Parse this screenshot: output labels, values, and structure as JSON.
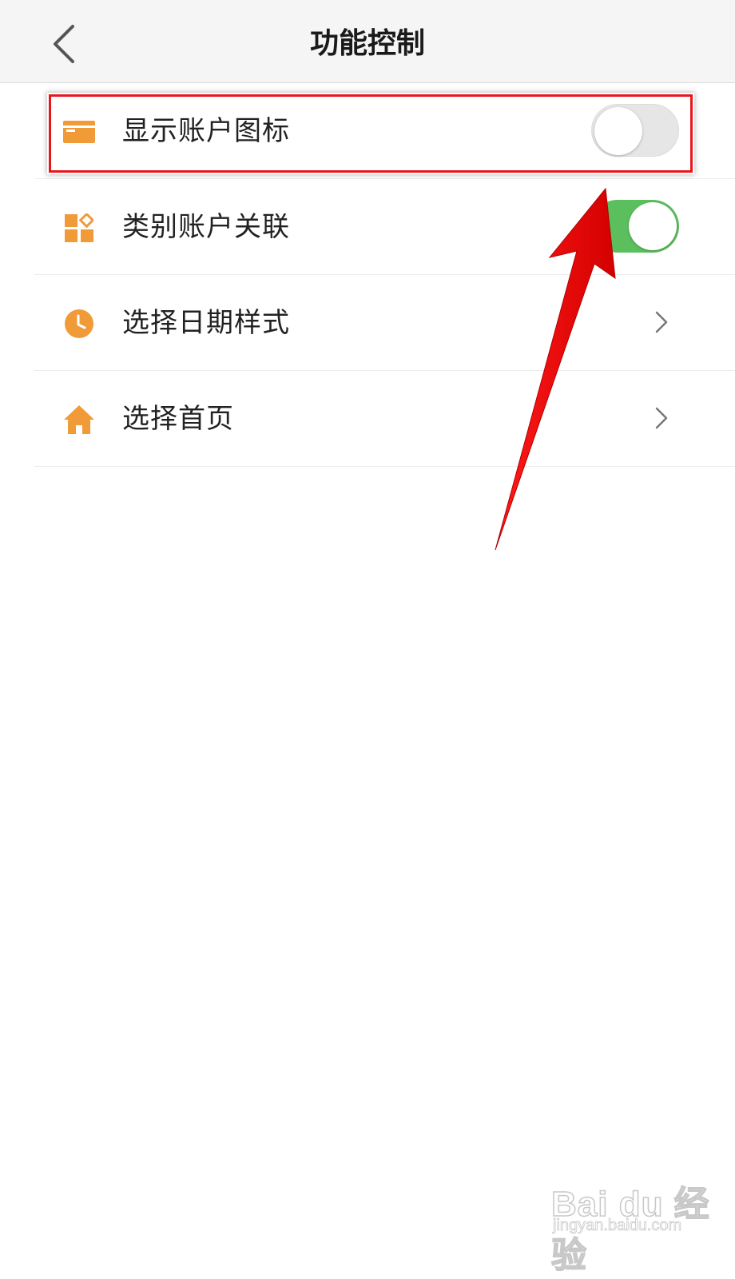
{
  "header": {
    "title": "功能控制",
    "back_icon": "chevron-left-icon"
  },
  "colors": {
    "icon_orange": "#f19a38",
    "toggle_on": "#5cbf5e",
    "toggle_off": "#e6e6e6",
    "annotation_red": "#e8161c"
  },
  "settings": {
    "items": [
      {
        "label": "显示账户图标",
        "icon": "card-icon",
        "control": "toggle",
        "state": "off"
      },
      {
        "label": "类别账户关联",
        "icon": "category-grid-icon",
        "control": "toggle",
        "state": "on"
      },
      {
        "label": "选择日期样式",
        "icon": "clock-icon",
        "control": "chevron"
      },
      {
        "label": "选择首页",
        "icon": "home-icon",
        "control": "chevron"
      }
    ]
  },
  "watermark": {
    "brand": "Bai du 经验",
    "url": "jingyan.baidu.com"
  }
}
